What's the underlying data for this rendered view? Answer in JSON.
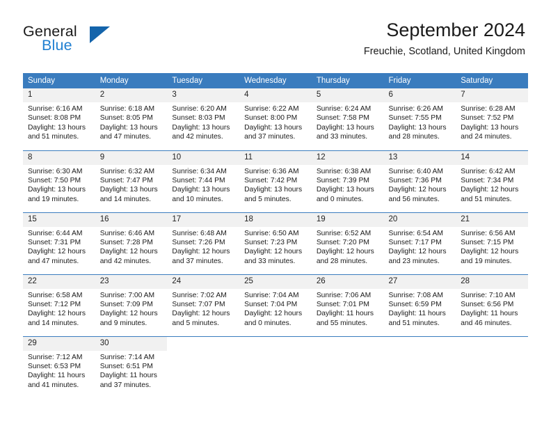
{
  "branding": {
    "name_part1": "General",
    "name_part2": "Blue",
    "accent_color": "#1f7fd1",
    "triangle_color": "#1464ab"
  },
  "header": {
    "title": "September 2024",
    "location": "Freuchie, Scotland, United Kingdom"
  },
  "theme": {
    "header_row_color": "#3a7cbe",
    "daynum_strip_color": "#f1f1f1",
    "row_divider_color": "#3a7cbe"
  },
  "weekday_headers": [
    "Sunday",
    "Monday",
    "Tuesday",
    "Wednesday",
    "Thursday",
    "Friday",
    "Saturday"
  ],
  "weeks": [
    {
      "days": [
        {
          "num": "1",
          "sunrise": "Sunrise: 6:16 AM",
          "sunset": "Sunset: 8:08 PM",
          "daylight1": "Daylight: 13 hours",
          "daylight2": "and 51 minutes."
        },
        {
          "num": "2",
          "sunrise": "Sunrise: 6:18 AM",
          "sunset": "Sunset: 8:05 PM",
          "daylight1": "Daylight: 13 hours",
          "daylight2": "and 47 minutes."
        },
        {
          "num": "3",
          "sunrise": "Sunrise: 6:20 AM",
          "sunset": "Sunset: 8:03 PM",
          "daylight1": "Daylight: 13 hours",
          "daylight2": "and 42 minutes."
        },
        {
          "num": "4",
          "sunrise": "Sunrise: 6:22 AM",
          "sunset": "Sunset: 8:00 PM",
          "daylight1": "Daylight: 13 hours",
          "daylight2": "and 37 minutes."
        },
        {
          "num": "5",
          "sunrise": "Sunrise: 6:24 AM",
          "sunset": "Sunset: 7:58 PM",
          "daylight1": "Daylight: 13 hours",
          "daylight2": "and 33 minutes."
        },
        {
          "num": "6",
          "sunrise": "Sunrise: 6:26 AM",
          "sunset": "Sunset: 7:55 PM",
          "daylight1": "Daylight: 13 hours",
          "daylight2": "and 28 minutes."
        },
        {
          "num": "7",
          "sunrise": "Sunrise: 6:28 AM",
          "sunset": "Sunset: 7:52 PM",
          "daylight1": "Daylight: 13 hours",
          "daylight2": "and 24 minutes."
        }
      ]
    },
    {
      "days": [
        {
          "num": "8",
          "sunrise": "Sunrise: 6:30 AM",
          "sunset": "Sunset: 7:50 PM",
          "daylight1": "Daylight: 13 hours",
          "daylight2": "and 19 minutes."
        },
        {
          "num": "9",
          "sunrise": "Sunrise: 6:32 AM",
          "sunset": "Sunset: 7:47 PM",
          "daylight1": "Daylight: 13 hours",
          "daylight2": "and 14 minutes."
        },
        {
          "num": "10",
          "sunrise": "Sunrise: 6:34 AM",
          "sunset": "Sunset: 7:44 PM",
          "daylight1": "Daylight: 13 hours",
          "daylight2": "and 10 minutes."
        },
        {
          "num": "11",
          "sunrise": "Sunrise: 6:36 AM",
          "sunset": "Sunset: 7:42 PM",
          "daylight1": "Daylight: 13 hours",
          "daylight2": "and 5 minutes."
        },
        {
          "num": "12",
          "sunrise": "Sunrise: 6:38 AM",
          "sunset": "Sunset: 7:39 PM",
          "daylight1": "Daylight: 13 hours",
          "daylight2": "and 0 minutes."
        },
        {
          "num": "13",
          "sunrise": "Sunrise: 6:40 AM",
          "sunset": "Sunset: 7:36 PM",
          "daylight1": "Daylight: 12 hours",
          "daylight2": "and 56 minutes."
        },
        {
          "num": "14",
          "sunrise": "Sunrise: 6:42 AM",
          "sunset": "Sunset: 7:34 PM",
          "daylight1": "Daylight: 12 hours",
          "daylight2": "and 51 minutes."
        }
      ]
    },
    {
      "days": [
        {
          "num": "15",
          "sunrise": "Sunrise: 6:44 AM",
          "sunset": "Sunset: 7:31 PM",
          "daylight1": "Daylight: 12 hours",
          "daylight2": "and 47 minutes."
        },
        {
          "num": "16",
          "sunrise": "Sunrise: 6:46 AM",
          "sunset": "Sunset: 7:28 PM",
          "daylight1": "Daylight: 12 hours",
          "daylight2": "and 42 minutes."
        },
        {
          "num": "17",
          "sunrise": "Sunrise: 6:48 AM",
          "sunset": "Sunset: 7:26 PM",
          "daylight1": "Daylight: 12 hours",
          "daylight2": "and 37 minutes."
        },
        {
          "num": "18",
          "sunrise": "Sunrise: 6:50 AM",
          "sunset": "Sunset: 7:23 PM",
          "daylight1": "Daylight: 12 hours",
          "daylight2": "and 33 minutes."
        },
        {
          "num": "19",
          "sunrise": "Sunrise: 6:52 AM",
          "sunset": "Sunset: 7:20 PM",
          "daylight1": "Daylight: 12 hours",
          "daylight2": "and 28 minutes."
        },
        {
          "num": "20",
          "sunrise": "Sunrise: 6:54 AM",
          "sunset": "Sunset: 7:17 PM",
          "daylight1": "Daylight: 12 hours",
          "daylight2": "and 23 minutes."
        },
        {
          "num": "21",
          "sunrise": "Sunrise: 6:56 AM",
          "sunset": "Sunset: 7:15 PM",
          "daylight1": "Daylight: 12 hours",
          "daylight2": "and 19 minutes."
        }
      ]
    },
    {
      "days": [
        {
          "num": "22",
          "sunrise": "Sunrise: 6:58 AM",
          "sunset": "Sunset: 7:12 PM",
          "daylight1": "Daylight: 12 hours",
          "daylight2": "and 14 minutes."
        },
        {
          "num": "23",
          "sunrise": "Sunrise: 7:00 AM",
          "sunset": "Sunset: 7:09 PM",
          "daylight1": "Daylight: 12 hours",
          "daylight2": "and 9 minutes."
        },
        {
          "num": "24",
          "sunrise": "Sunrise: 7:02 AM",
          "sunset": "Sunset: 7:07 PM",
          "daylight1": "Daylight: 12 hours",
          "daylight2": "and 5 minutes."
        },
        {
          "num": "25",
          "sunrise": "Sunrise: 7:04 AM",
          "sunset": "Sunset: 7:04 PM",
          "daylight1": "Daylight: 12 hours",
          "daylight2": "and 0 minutes."
        },
        {
          "num": "26",
          "sunrise": "Sunrise: 7:06 AM",
          "sunset": "Sunset: 7:01 PM",
          "daylight1": "Daylight: 11 hours",
          "daylight2": "and 55 minutes."
        },
        {
          "num": "27",
          "sunrise": "Sunrise: 7:08 AM",
          "sunset": "Sunset: 6:59 PM",
          "daylight1": "Daylight: 11 hours",
          "daylight2": "and 51 minutes."
        },
        {
          "num": "28",
          "sunrise": "Sunrise: 7:10 AM",
          "sunset": "Sunset: 6:56 PM",
          "daylight1": "Daylight: 11 hours",
          "daylight2": "and 46 minutes."
        }
      ]
    },
    {
      "days": [
        {
          "num": "29",
          "sunrise": "Sunrise: 7:12 AM",
          "sunset": "Sunset: 6:53 PM",
          "daylight1": "Daylight: 11 hours",
          "daylight2": "and 41 minutes."
        },
        {
          "num": "30",
          "sunrise": "Sunrise: 7:14 AM",
          "sunset": "Sunset: 6:51 PM",
          "daylight1": "Daylight: 11 hours",
          "daylight2": "and 37 minutes."
        },
        {
          "num": "",
          "sunrise": "",
          "sunset": "",
          "daylight1": "",
          "daylight2": ""
        },
        {
          "num": "",
          "sunrise": "",
          "sunset": "",
          "daylight1": "",
          "daylight2": ""
        },
        {
          "num": "",
          "sunrise": "",
          "sunset": "",
          "daylight1": "",
          "daylight2": ""
        },
        {
          "num": "",
          "sunrise": "",
          "sunset": "",
          "daylight1": "",
          "daylight2": ""
        },
        {
          "num": "",
          "sunrise": "",
          "sunset": "",
          "daylight1": "",
          "daylight2": ""
        }
      ]
    }
  ]
}
